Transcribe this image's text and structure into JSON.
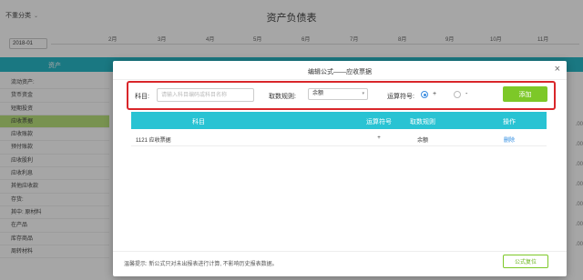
{
  "background": {
    "category_select": "不重分类",
    "page_title": "资产负债表",
    "date_value": "2018-01",
    "months": [
      "2月",
      "3月",
      "4月",
      "5月",
      "6月",
      "7月",
      "8月",
      "9月",
      "10月",
      "11月"
    ],
    "table_header": "资产",
    "rows": [
      "流动资产:",
      "货币资金",
      "短期投资",
      "应收票据",
      "应收账款",
      "预付账款",
      "应收股利",
      "应收利息",
      "其他应收款",
      "存货:",
      "其中: 原材料",
      "在产品",
      "库存商品",
      "周转材料"
    ],
    "highlighted_row": 3,
    "right_values": [
      ".00",
      ".00",
      ".00",
      ".00",
      ".00",
      ".00",
      ".00"
    ]
  },
  "modal": {
    "title": "编辑公式——应收票据",
    "close_icon": "close-icon",
    "form": {
      "subject_label": "科目:",
      "subject_placeholder": "请输入科目编码或科目名称",
      "rule_label": "取数规则:",
      "rule_value": "余额",
      "operator_label": "运算符号:",
      "op_plus": "+",
      "op_minus": "-",
      "selected_operator": "+",
      "add_button": "添加"
    },
    "table": {
      "headers": [
        "科目",
        "运算符号",
        "取数规则",
        "操作"
      ],
      "rows": [
        {
          "subject": "1121 应收票据",
          "operator": "+",
          "rule": "余额",
          "action": "删除"
        }
      ]
    },
    "hint": "温馨提示: 新公式只对未出报表进行计算, 不影响历史报表数据。",
    "check_button": "公式复位"
  }
}
